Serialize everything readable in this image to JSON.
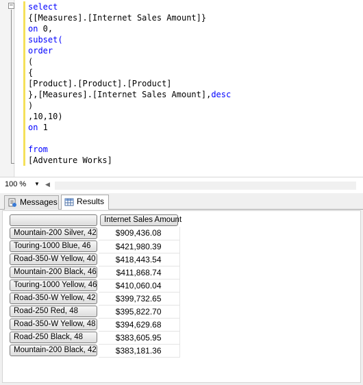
{
  "editor": {
    "lines": [
      [
        {
          "t": "select",
          "c": "kw"
        }
      ],
      [
        {
          "t": "{[Measures].[Internet Sales Amount]}",
          "c": ""
        }
      ],
      [
        {
          "t": "on",
          "c": "kw"
        },
        {
          "t": " 0,",
          "c": ""
        }
      ],
      [
        {
          "t": "subset(",
          "c": "kw"
        }
      ],
      [
        {
          "t": "order",
          "c": "kw"
        }
      ],
      [
        {
          "t": "(",
          "c": ""
        }
      ],
      [
        {
          "t": "{",
          "c": ""
        }
      ],
      [
        {
          "t": "[Product].[Product].[Product]",
          "c": ""
        }
      ],
      [
        {
          "t": "},[Measures].[Internet Sales Amount],",
          "c": ""
        },
        {
          "t": "desc",
          "c": "kw"
        }
      ],
      [
        {
          "t": ")",
          "c": ""
        }
      ],
      [
        {
          "t": ",10,10)",
          "c": ""
        }
      ],
      [
        {
          "t": "on",
          "c": "kw"
        },
        {
          "t": " 1",
          "c": ""
        }
      ],
      [
        {
          "t": "",
          "c": ""
        }
      ],
      [
        {
          "t": "from",
          "c": "kw"
        }
      ],
      [
        {
          "t": "[Adventure Works]",
          "c": ""
        }
      ]
    ],
    "fold_symbol": "−"
  },
  "zoom": {
    "value": "100 %",
    "arrow": "▼",
    "scroll_left": "◀"
  },
  "tabs": {
    "messages_label": "Messages",
    "results_label": "Results"
  },
  "grid": {
    "corner_label": "",
    "column_header": "Internet Sales Amount",
    "rows": [
      {
        "label": "Mountain-200 Silver, 42",
        "value": "$909,436.08"
      },
      {
        "label": "Touring-1000 Blue, 46",
        "value": "$421,980.39"
      },
      {
        "label": "Road-350-W Yellow, 40",
        "value": "$418,443.54"
      },
      {
        "label": "Mountain-200 Black, 46",
        "value": "$411,868.74"
      },
      {
        "label": "Touring-1000 Yellow, 46",
        "value": "$410,060.04"
      },
      {
        "label": "Road-350-W Yellow, 42",
        "value": "$399,732.65"
      },
      {
        "label": "Road-250 Red, 48",
        "value": "$395,822.70"
      },
      {
        "label": "Road-350-W Yellow, 48",
        "value": "$394,629.68"
      },
      {
        "label": "Road-250 Black, 48",
        "value": "$383,605.95"
      },
      {
        "label": "Mountain-200 Black, 42",
        "value": "$383,181.36"
      }
    ]
  },
  "colors": {
    "keyword": "#0000ff",
    "text": "#000000",
    "change_bar": "#f5e15a",
    "pane_background": "#f0f0f0"
  }
}
